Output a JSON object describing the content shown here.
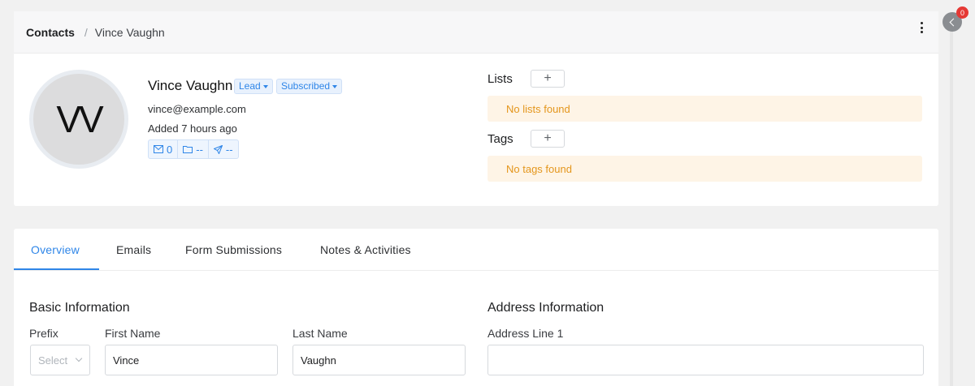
{
  "breadcrumb": {
    "root": "Contacts",
    "separator": "/",
    "current": "Vince Vaughn"
  },
  "contact": {
    "initials": "VV",
    "name": "Vince Vaughn",
    "status_badge": "Lead",
    "subscription_badge": "Subscribed",
    "email": "vince@example.com",
    "added": "Added 7 hours ago",
    "stats": {
      "emails": "0",
      "lists": "--",
      "campaigns": "--"
    }
  },
  "lists": {
    "label": "Lists",
    "add": "+",
    "empty": "No lists found"
  },
  "tags": {
    "label": "Tags",
    "add": "+",
    "empty": "No tags found"
  },
  "tabs": [
    {
      "label": "Overview",
      "active": true
    },
    {
      "label": "Emails"
    },
    {
      "label": "Form Submissions"
    },
    {
      "label": "Notes & Activities"
    }
  ],
  "basic_info": {
    "title": "Basic Information",
    "prefix_label": "Prefix",
    "prefix_value": "Select",
    "first_name_label": "First Name",
    "first_name_value": "Vince",
    "last_name_label": "Last Name",
    "last_name_value": "Vaughn"
  },
  "address_info": {
    "title": "Address Information",
    "line1_label": "Address Line 1",
    "line1_value": ""
  },
  "sidebar": {
    "notification_count": "0"
  },
  "colors": {
    "accent": "#2f86e8",
    "warning_text": "#e4961c",
    "warning_bg": "#fef4e6",
    "badge_red": "#e53935"
  },
  "icons": [
    "kebab-menu-icon",
    "envelope-icon",
    "folder-icon",
    "send-icon",
    "plus-icon",
    "chevron-down-icon",
    "chevron-left-icon"
  ]
}
